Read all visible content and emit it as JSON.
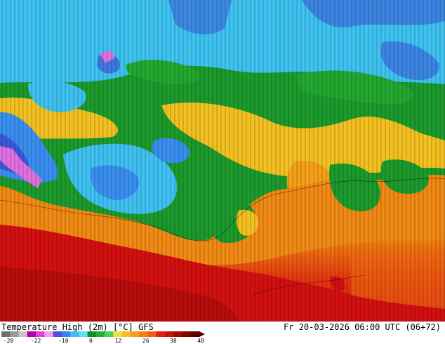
{
  "map": {
    "region": "Europe / Africa / Middle East",
    "field": "temperature-high-2m",
    "regions": [
      {
        "name": "cold-north",
        "color": "#3fc0f0"
      },
      {
        "name": "very-cold-pockets",
        "color": "#3a5ad8"
      },
      {
        "name": "frost",
        "color": "#e070e0"
      },
      {
        "name": "mild-belt",
        "color": "#1c9a2c"
      },
      {
        "name": "warm-band",
        "color": "#f2c020"
      },
      {
        "name": "hot-south",
        "color": "#f08010"
      },
      {
        "name": "very-hot-africa",
        "color": "#d21010"
      }
    ]
  },
  "footer": {
    "title": "Temperature High (2m) [°C] GFS",
    "valid_time": "Fr 20-03-2026 06:00 UTC (06+72)"
  },
  "colorbar": {
    "labels": [
      "-28",
      "-22",
      "-10",
      "0",
      "12",
      "26",
      "38",
      "48"
    ],
    "colors": [
      "#6e6e6e",
      "#9a9a9a",
      "#c8c8c8",
      "#b000b0",
      "#e040e0",
      "#f0a0f0",
      "#5050e0",
      "#3a80f0",
      "#40c0f0",
      "#60e0f0",
      "#109020",
      "#20b040",
      "#50d050",
      "#f0e040",
      "#f0c020",
      "#f0a020",
      "#f08010",
      "#f06010",
      "#e02010",
      "#c81010",
      "#a00808",
      "#800000",
      "#5a0000"
    ]
  }
}
